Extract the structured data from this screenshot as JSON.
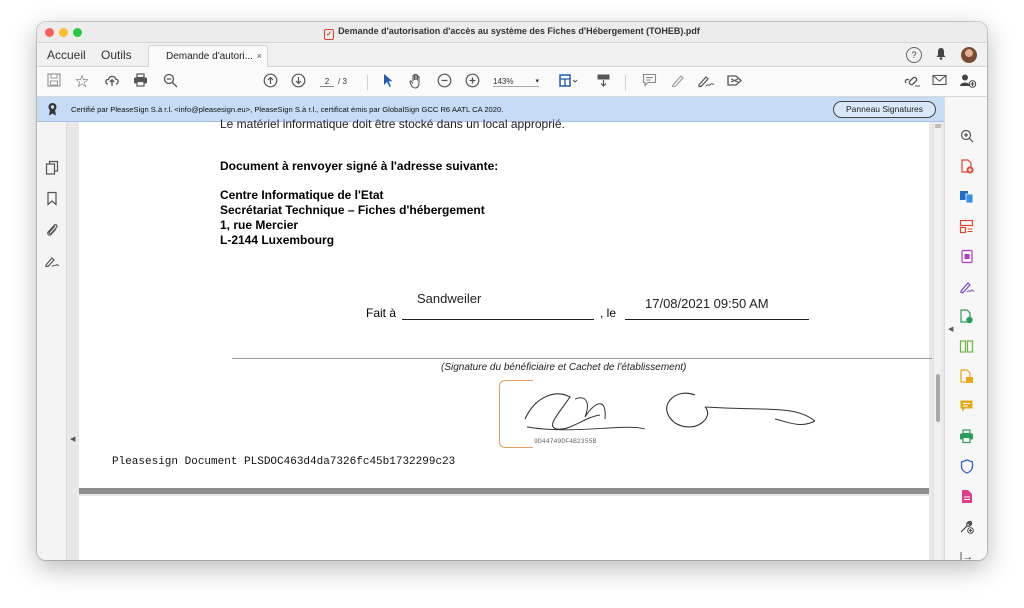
{
  "window": {
    "title": "Demande d'autorisation d'accès au système des Fiches d'Hébergement (TOHEB).pdf"
  },
  "tabs": {
    "home": "Accueil",
    "tools": "Outils",
    "document": "Demande d'autori...",
    "close": "×"
  },
  "toolbar": {
    "page_current": "2",
    "page_total": "/ 3",
    "zoom": "143%"
  },
  "certificate": {
    "text": "Certifié par PleaseSign S.à r.l. <info@pleasesign.eu>, PleaseSign S.à r.l., certificat émis par GlobalSign GCC R6 AATL CA 2020.",
    "panel_button": "Panneau Signatures"
  },
  "document": {
    "cut_line": "Le matériel informatique doit être stocké dans un local approprié.",
    "return_heading": "Document à renvoyer signé à l'adresse suivante:",
    "address": [
      "Centre Informatique de l'Etat",
      "Secrétariat Technique – Fiches d'hébergement",
      "1, rue Mercier",
      "L-2144 Luxembourg"
    ],
    "fait_label": "Fait à",
    "place_value": "Sandweiler",
    "le_label": ", le",
    "date_value": "17/08/2021 09:50 AM",
    "signature_caption": "(Signature du bénéficiaire et Cachet de l'établissement)",
    "signature_name": "Mikael Grandsire",
    "signature_id": "9D44749DF4B2355B",
    "footer_id": "Pleasesign Document PLSDOC463d4da7326fc45b1732299c23"
  },
  "colors": {
    "cert_bar": "#c6dcf6",
    "stamp_border": "#e0a060",
    "pdf_red": "#d8432f"
  },
  "icons": {
    "left_rail": [
      "pages-icon",
      "bookmark-icon",
      "attachment-icon",
      "signature-pen-icon"
    ],
    "right_rail": [
      "zoom-search-icon",
      "create-pdf-icon",
      "export-pdf-icon",
      "organize-pages-icon",
      "edit-pdf-icon",
      "fill-sign-icon",
      "combine-files-icon",
      "compare-icon",
      "scan-icon",
      "comment-icon",
      "print-production-icon",
      "protect-icon",
      "request-signature-icon",
      "more-tools-icon",
      "collapse-panel-icon"
    ]
  }
}
